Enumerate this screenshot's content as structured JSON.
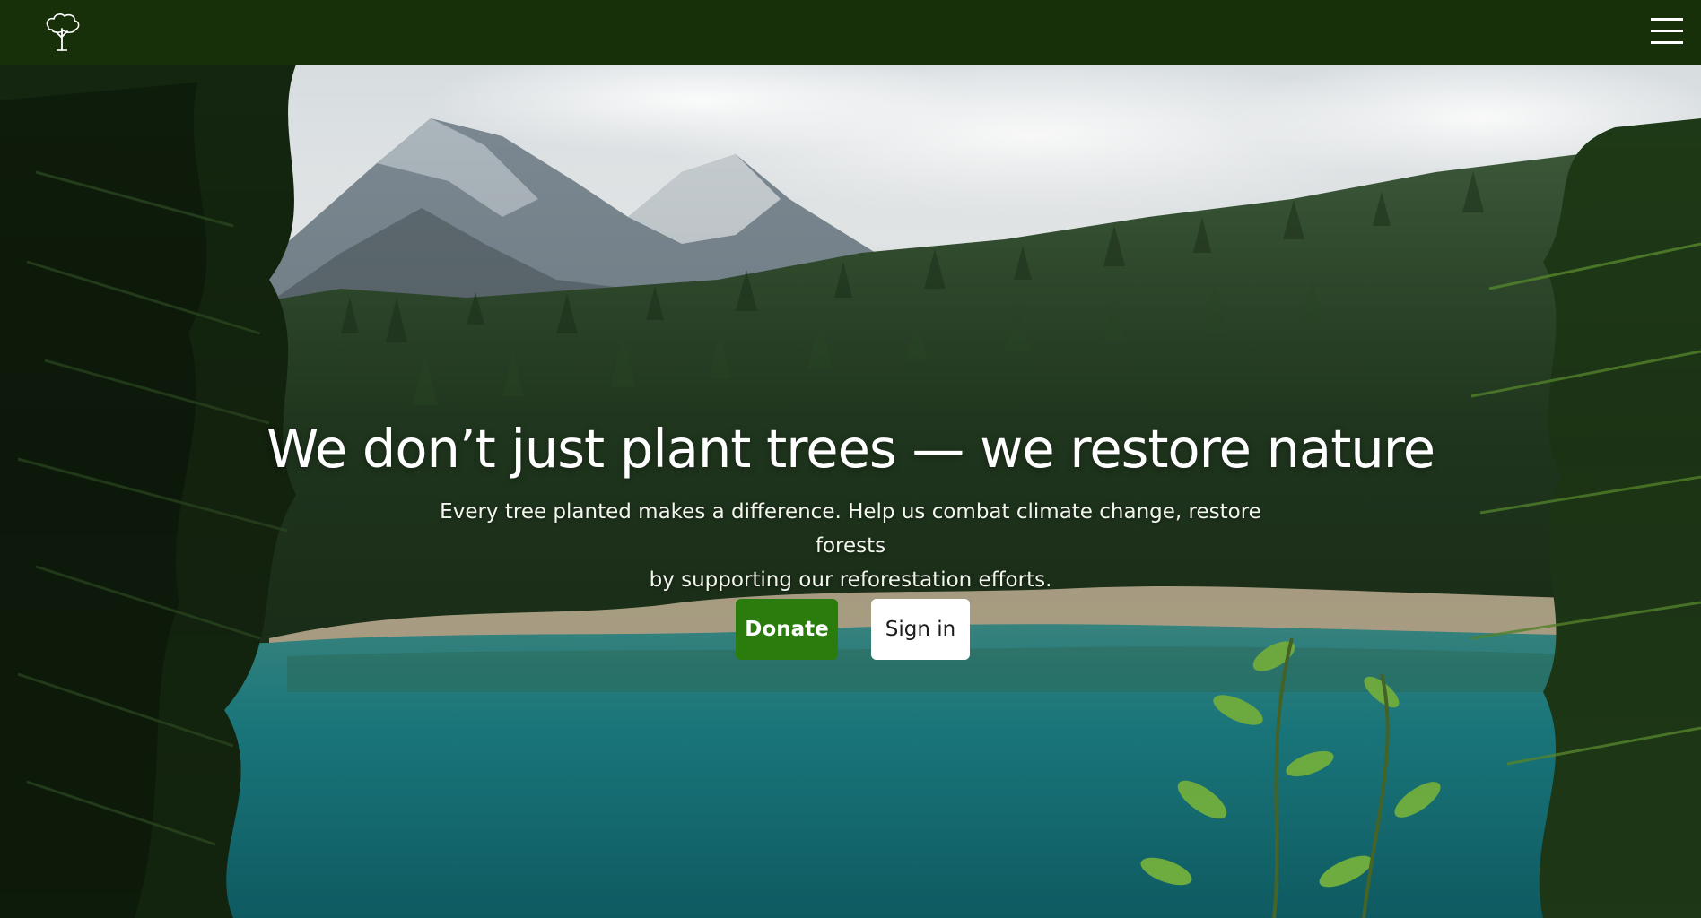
{
  "nav": {
    "logo_icon": "tree-logo-icon",
    "menu_icon": "hamburger-menu-icon"
  },
  "hero": {
    "headline": "We don’t just plant trees — we restore nature",
    "subtext_line1": "Every tree planted makes a difference. Help us combat climate change, restore forests",
    "subtext_line2": "by supporting our reforestation efforts.",
    "donate_label": "Donate",
    "signin_label": "Sign in"
  },
  "colors": {
    "navbar_bg": "#17300a",
    "donate_bg": "#2a7d0c",
    "signin_bg": "#ffffff",
    "text": "#ffffff"
  }
}
